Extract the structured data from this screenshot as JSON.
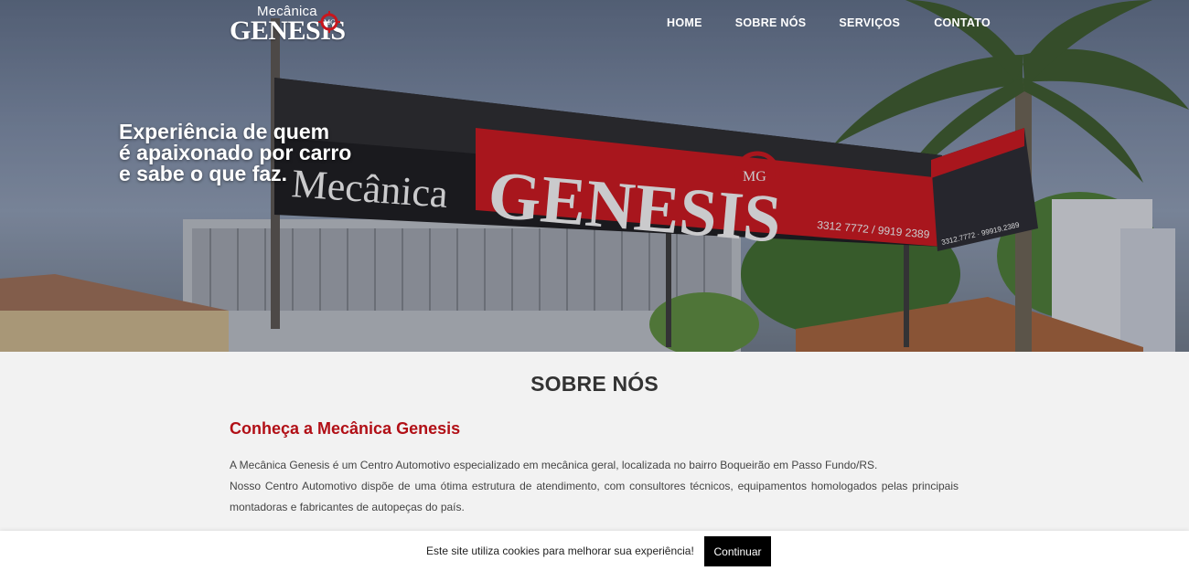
{
  "logo": {
    "small_text": "Mecânica",
    "big_text": "GENESIS",
    "badge": "MG"
  },
  "nav": {
    "items": [
      "HOME",
      "SOBRE NÓS",
      "SERVIÇOS",
      "CONTATO"
    ]
  },
  "hero": {
    "title_lines": [
      "Experiência de quem",
      "é apaixonado por carro",
      "e sabe o que faz."
    ],
    "sign_word_1": "Mecânica",
    "sign_word_2": "GENESIS",
    "sign_badge": "MG",
    "sign_phone": "3312 7772 / 9919 2389",
    "side_phone": "3312.7772 · 99919.2389"
  },
  "about": {
    "heading": "SOBRE NÓS",
    "subheading": "Conheça a Mecânica Genesis",
    "para1": "A Mecânica Genesis é um Centro Automotivo especializado em mecânica geral, localizada no bairro Boqueirão em Passo Fundo/RS.",
    "para2": "Nosso Centro Automotivo dispõe de uma ótima estrutura de atendimento, com consultores técnicos, equipamentos homologados pelas principais montadoras e fabricantes de autopeças do país."
  },
  "cookie": {
    "message": "Este site utiliza cookies para melhorar sua experiência!",
    "button": "Continuar"
  },
  "colors": {
    "brand_red": "#b10f16",
    "sign_red": "#c8161d",
    "cookie_button": "#000000"
  }
}
